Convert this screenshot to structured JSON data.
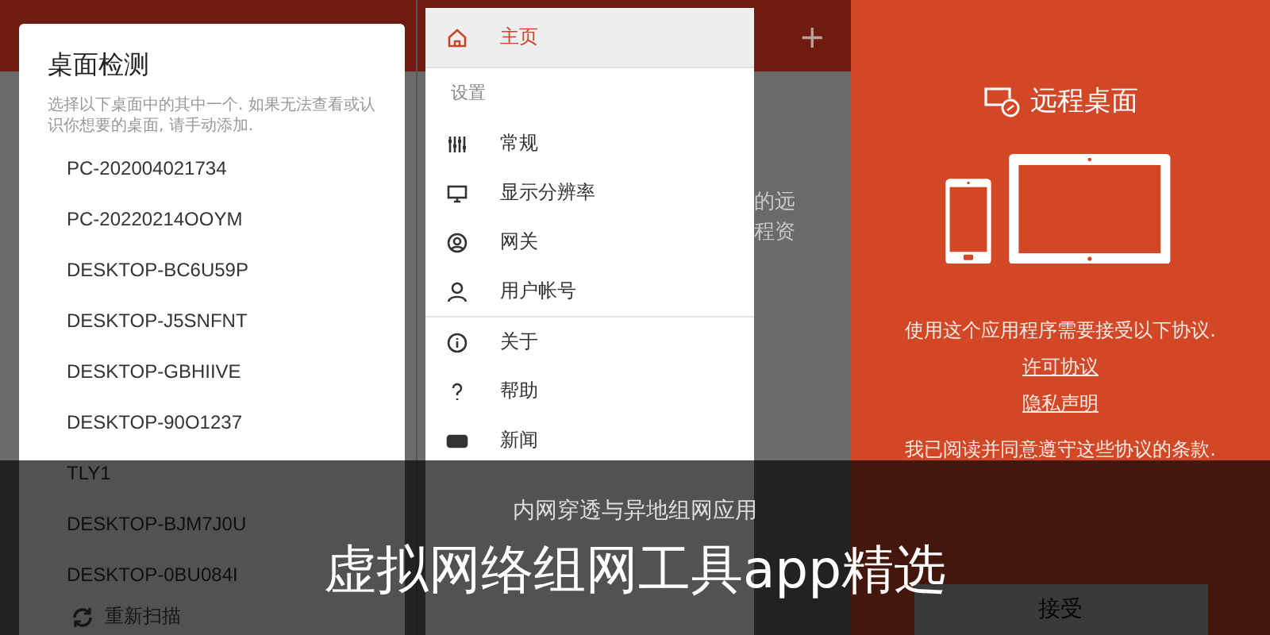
{
  "detect_dialog": {
    "title": "桌面检测",
    "description": "选择以下桌面中的其中一个. 如果无法查看或认识你想要的桌面, 请手动添加.",
    "desktops": [
      "PC-202004021734",
      "PC-20220214OOYM",
      "DESKTOP-BC6U59P",
      "DESKTOP-J5SNFNT",
      "DESKTOP-GBHIIVE",
      "DESKTOP-90O1237",
      "TLY1",
      "DESKTOP-BJM7J0U",
      "DESKTOP-0BU084I"
    ],
    "rescan_button": "重新扫描"
  },
  "nav_drawer": {
    "add_button": "+",
    "background_text": [
      "的远",
      "程资"
    ],
    "groups": [
      {
        "items": [
          {
            "label": "主页",
            "selected": true
          }
        ]
      },
      {
        "header": "设置",
        "items": [
          {
            "label": "常规",
            "selected": false
          },
          {
            "label": "显示分辨率",
            "selected": false
          },
          {
            "label": "网关",
            "selected": false
          },
          {
            "label": "用户帐号",
            "selected": false
          }
        ]
      },
      {
        "items": [
          {
            "label": "关于",
            "selected": false
          },
          {
            "label": "帮助",
            "selected": false
          },
          {
            "label": "新闻",
            "selected": false
          }
        ]
      }
    ]
  },
  "welcome": {
    "app_name": "远程桌面",
    "notice": "使用这个应用程序需要接受以下协议.",
    "links": [
      "许可协议",
      "隐私声明"
    ],
    "agreement": "我已阅读并同意遵守这些协议的条款.",
    "accept_button": "接受"
  },
  "banner": {
    "subtitle": "内网穿透与异地组网应用",
    "title": "虚拟网络组网工具app精选"
  }
}
